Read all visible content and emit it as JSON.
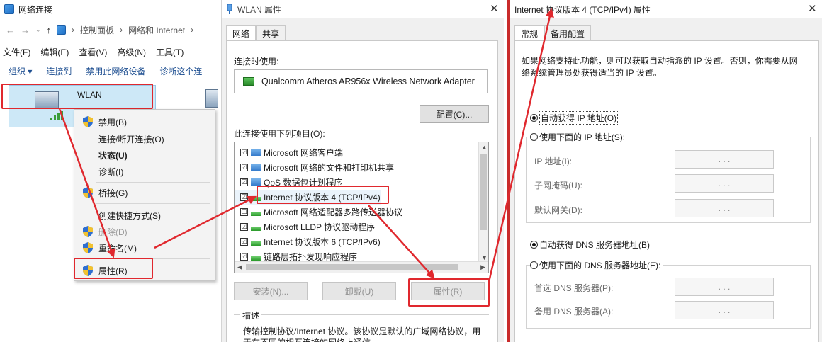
{
  "net_connections": {
    "title": "网络连接",
    "breadcrumb": [
      "控制面板",
      "网络和 Internet"
    ],
    "menu": [
      "文件(F)",
      "编辑(E)",
      "查看(V)",
      "高级(N)",
      "工具(T)"
    ],
    "commands": [
      "组织 ▾",
      "连接到",
      "禁用此网络设备",
      "诊断这个连"
    ],
    "wlan_name": "WLAN",
    "context_menu": [
      "禁用(B)",
      "连接/断开连接(O)",
      "状态(U)",
      "诊断(I)",
      "桥接(G)",
      "创建快捷方式(S)",
      "删除(D)",
      "重命名(M)",
      "属性(R)"
    ]
  },
  "wlan_props": {
    "title": "WLAN 属性",
    "tabs": [
      "网络",
      "共享"
    ],
    "connect_using_label": "连接时使用:",
    "adapter": "Qualcomm Atheros AR956x Wireless Network Adapter",
    "configure_button": "配置(C)...",
    "items_label": "此连接使用下列项目(O):",
    "items": [
      {
        "label": "Microsoft 网络客户端",
        "checked": "☑"
      },
      {
        "label": "Microsoft 网络的文件和打印机共享",
        "checked": "☑"
      },
      {
        "label": "QoS 数据包计划程序",
        "checked": "☑"
      },
      {
        "label": "Internet 协议版本 4 (TCP/IPv4)",
        "checked": "☑"
      },
      {
        "label": "Microsoft 网络适配器多路传送器协议",
        "checked": "☐"
      },
      {
        "label": "Microsoft LLDP 协议驱动程序",
        "checked": "☑"
      },
      {
        "label": "Internet 协议版本 6 (TCP/IPv6)",
        "checked": "☑"
      },
      {
        "label": "链路层拓扑发现响应程序",
        "checked": "☑"
      }
    ],
    "install_button": "安装(N)...",
    "uninstall_button": "卸载(U)",
    "properties_button": "属性(R)",
    "description_label": "描述",
    "description_text": "传输控制协议/Internet 协议。该协议是默认的广域网络协议，用于在不同的相互连接的网络上通信。"
  },
  "ipv4_props": {
    "title": "Internet 协议版本 4 (TCP/IPv4) 属性",
    "tabs": [
      "常规",
      "备用配置"
    ],
    "intro": "如果网络支持此功能，则可以获取自动指派的 IP 设置。否则，你需要从网络系统管理员处获得适当的 IP 设置。",
    "auto_ip": "自动获得 IP 地址(O)",
    "manual_ip": "使用下面的 IP 地址(S):",
    "ip_address": "IP 地址(I):",
    "subnet_mask": "子网掩码(U):",
    "gateway": "默认网关(D):",
    "auto_dns": "自动获得 DNS 服务器地址(B)",
    "manual_dns": "使用下面的 DNS 服务器地址(E):",
    "preferred_dns": "首选 DNS 服务器(P):",
    "alternate_dns": "备用 DNS 服务器(A):",
    "ip_placeholder": ".       .       ."
  },
  "colors": {
    "highlight_red": "#e0282e",
    "selection_blue": "#cde8f7",
    "link_blue": "#1e4f91"
  },
  "icons": [
    "network-connections-icon",
    "shield-icon",
    "wifi-icon",
    "adapter-icon",
    "close-icon"
  ]
}
